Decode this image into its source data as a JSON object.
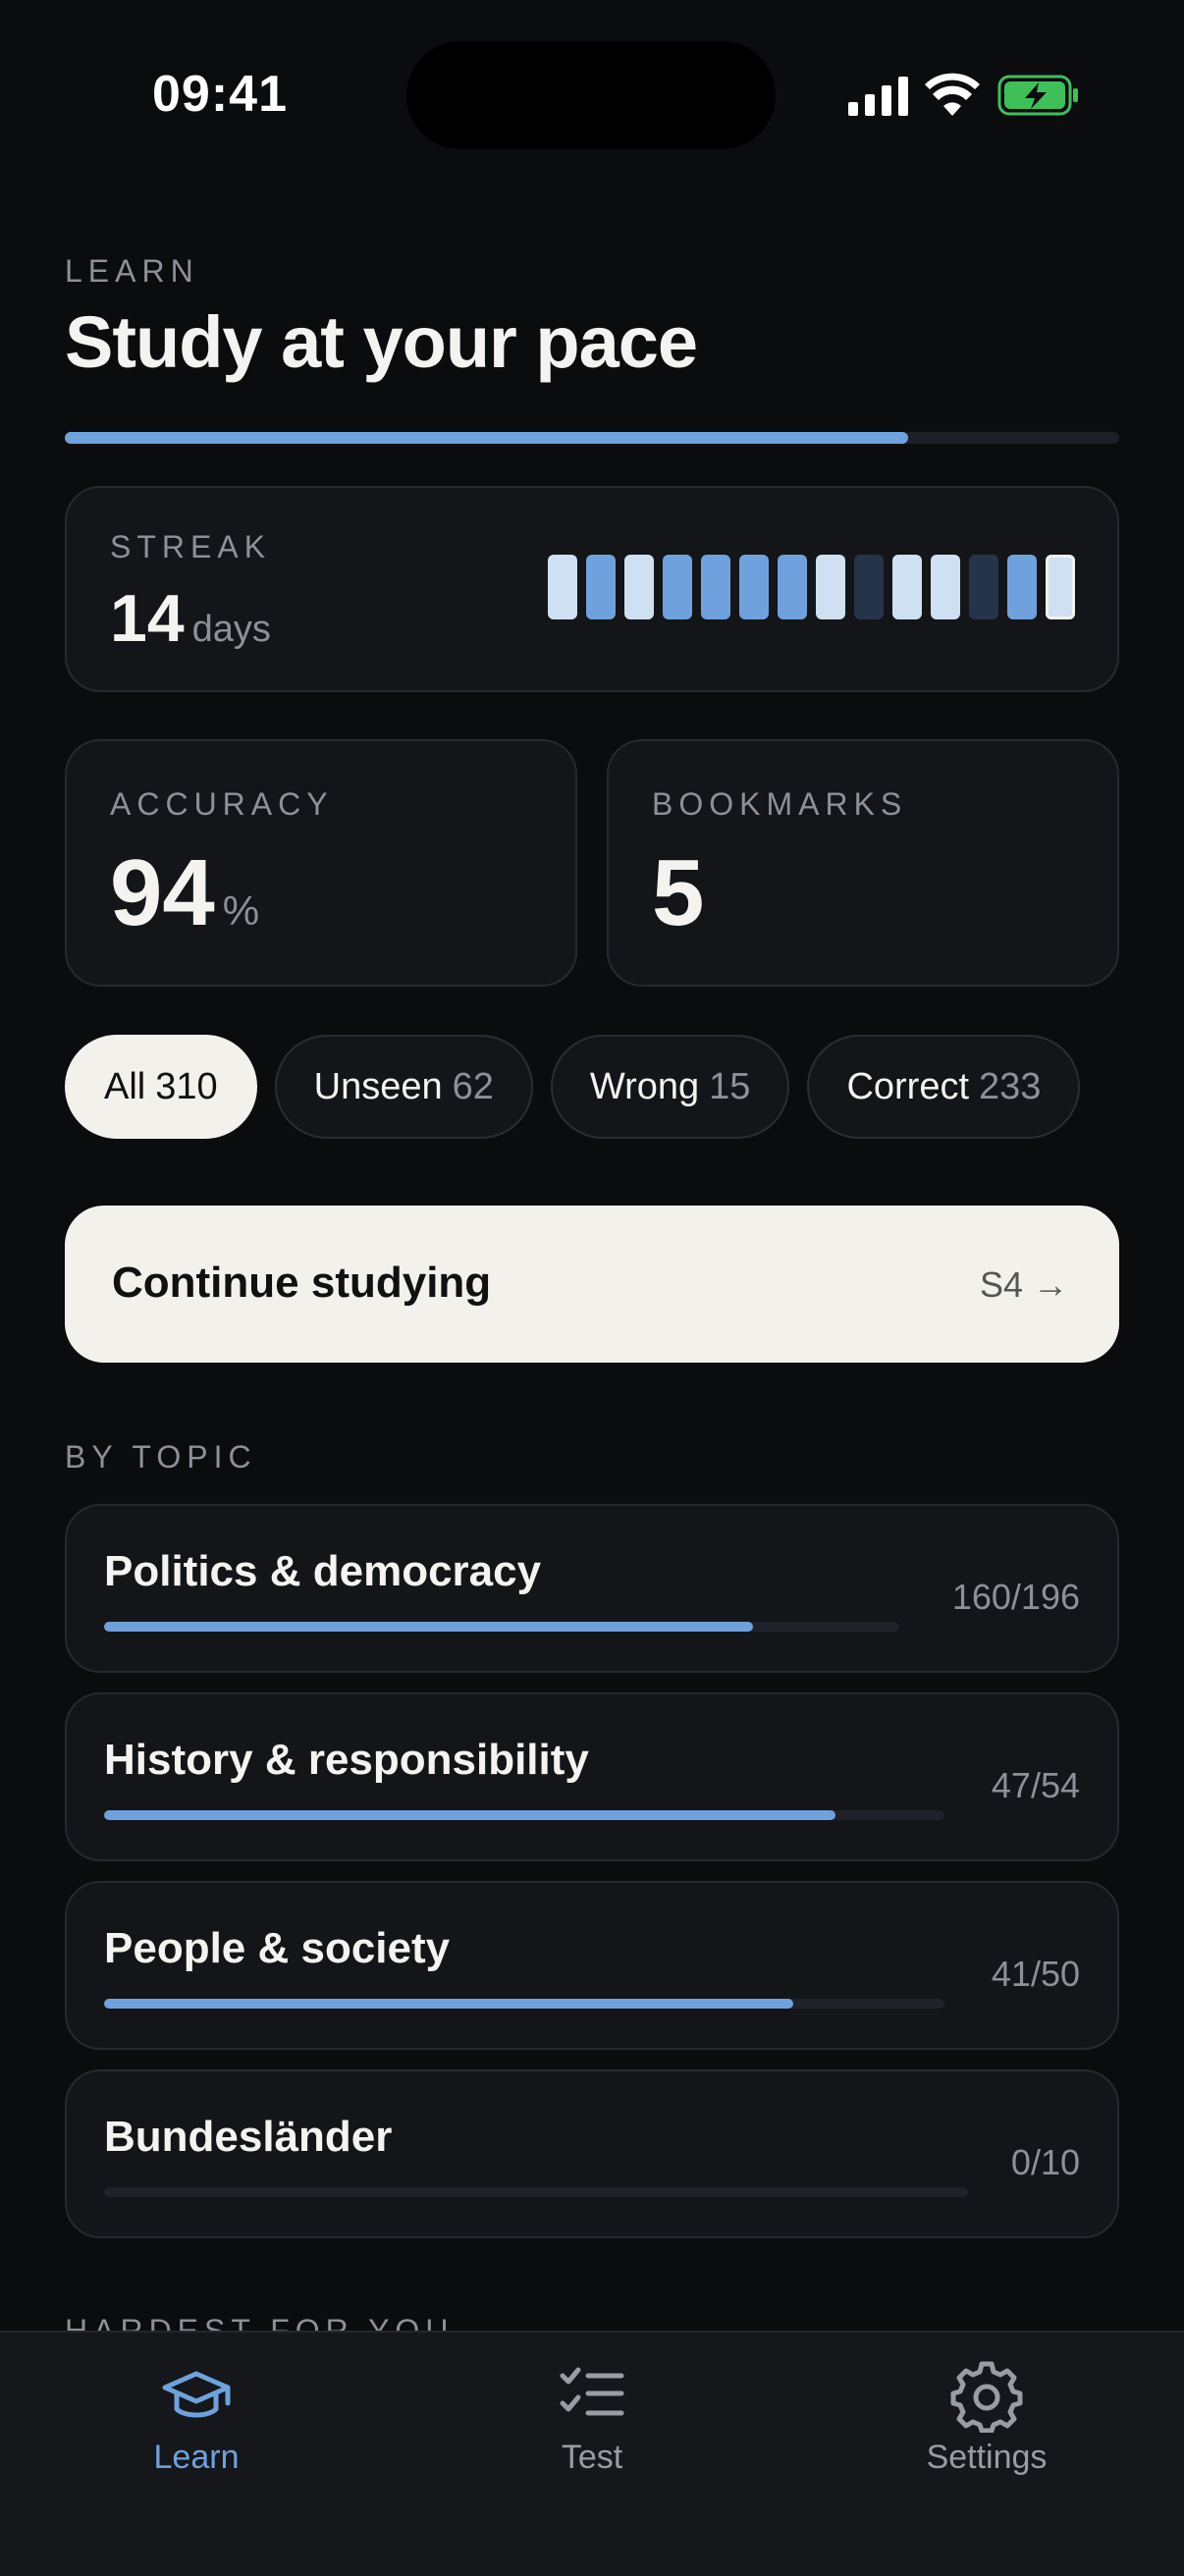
{
  "status_bar": {
    "time": "09:41"
  },
  "header": {
    "kicker": "LEARN",
    "title": "Study at your pace",
    "progress": 0.8
  },
  "streak": {
    "label": "STREAK",
    "value": "14",
    "unit": "days",
    "days": [
      "light",
      "blue",
      "light",
      "blue",
      "blue",
      "blue",
      "blue",
      "light",
      "dark",
      "light",
      "light",
      "dark",
      "blue",
      "light"
    ]
  },
  "accuracy": {
    "label": "ACCURACY",
    "value": "94",
    "unit": "%"
  },
  "bookmarks": {
    "label": "BOOKMARKS",
    "value": "5"
  },
  "filters": [
    {
      "label": "All",
      "count": "310",
      "active": true
    },
    {
      "label": "Unseen",
      "count": "62",
      "active": false
    },
    {
      "label": "Wrong",
      "count": "15",
      "active": false
    },
    {
      "label": "Correct",
      "count": "233",
      "active": false
    }
  ],
  "cta": {
    "label": "Continue studying",
    "badge": "S4 →"
  },
  "by_topic": {
    "heading": "BY TOPIC",
    "topics": [
      {
        "name": "Politics & democracy",
        "count": "160/196",
        "progress": 0.816
      },
      {
        "name": "History & responsibility",
        "count": "47/54",
        "progress": 0.87
      },
      {
        "name": "People & society",
        "count": "41/50",
        "progress": 0.82
      },
      {
        "name": "Bundesländer",
        "count": "0/10",
        "progress": 0
      }
    ]
  },
  "next_section": "HARDEST FOR YOU",
  "tabs": [
    {
      "label": "Learn",
      "icon": "graduation-cap-icon",
      "active": true
    },
    {
      "label": "Test",
      "icon": "checklist-icon",
      "active": false
    },
    {
      "label": "Settings",
      "icon": "gear-icon",
      "active": false
    }
  ],
  "colors": {
    "accent": "#6fa2dc",
    "block_light": "#cfe0f2",
    "block_blue": "#6fa2dc",
    "block_dark": "#26344a"
  }
}
